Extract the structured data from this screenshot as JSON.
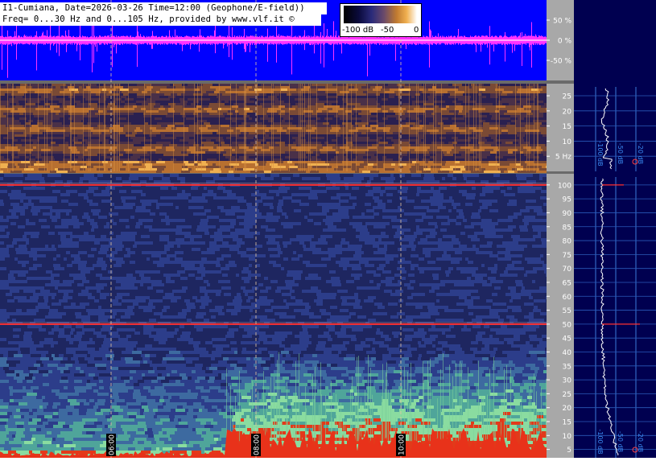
{
  "header": {
    "line1": "I1-Cumiana, Date=2026-03-26 Time=12:00 (Geophone/E-field))",
    "line2": "Freq= 0...30 Hz and 0...105 Hz, provided by www.vlf.it ©"
  },
  "colorbar": {
    "labels": [
      "-100 dB",
      "-50",
      "0"
    ]
  },
  "colors": {
    "waveform_bg": "#0000ff",
    "waveform": "#ff33ff",
    "axis_panel": "#a8a8a8",
    "right_panel": "#000050",
    "reference_line": "#ff3030"
  },
  "chart_data": [
    {
      "type": "line",
      "title": "waveform",
      "ylabel": "",
      "y_ticks": [
        "50 %",
        "0 %",
        "-50 %"
      ],
      "ylim": [
        -100,
        100
      ]
    },
    {
      "type": "heatmap",
      "title": "spectrogram 0...30 Hz",
      "unit_label": "Hz",
      "y_ticks": [
        {
          "label": "25",
          "v": 25
        },
        {
          "label": "20",
          "v": 20
        },
        {
          "label": "15",
          "v": 15
        },
        {
          "label": "10",
          "v": 10
        },
        {
          "label": "5 Hz",
          "v": 5
        }
      ],
      "ylim": [
        0,
        29
      ],
      "bands_hz": [
        7.8,
        14.3,
        20.8,
        27.3
      ],
      "time_markers": [
        "06:00",
        "08:00",
        "10:00"
      ],
      "spectrum_axis_labels": [
        "-100 dB",
        "-50 dB",
        "-20 dB"
      ]
    },
    {
      "type": "heatmap",
      "title": "spectrogram 0...105 Hz",
      "y_ticks": [
        {
          "label": "100",
          "v": 100
        },
        {
          "label": "95",
          "v": 95
        },
        {
          "label": "90",
          "v": 90
        },
        {
          "label": "85",
          "v": 85
        },
        {
          "label": "80",
          "v": 80
        },
        {
          "label": "75",
          "v": 75
        },
        {
          "label": "70",
          "v": 70
        },
        {
          "label": "65",
          "v": 65
        },
        {
          "label": "60",
          "v": 60
        },
        {
          "label": "55",
          "v": 55
        },
        {
          "label": "50",
          "v": 50
        },
        {
          "label": "45",
          "v": 45
        },
        {
          "label": "40",
          "v": 40
        },
        {
          "label": "35",
          "v": 35
        },
        {
          "label": "30",
          "v": 30
        },
        {
          "label": "25",
          "v": 25
        },
        {
          "label": "20",
          "v": 20
        },
        {
          "label": "15",
          "v": 15
        },
        {
          "label": "10",
          "v": 10
        },
        {
          "label": "5",
          "v": 5
        }
      ],
      "ylim": [
        2,
        104
      ],
      "line_frequencies_hz": [
        100,
        50
      ],
      "time_markers": [
        "06:00",
        "08:00",
        "10:00"
      ],
      "spectrum_axis_labels": [
        "-100 dB",
        "-50 dB",
        "-20 dB"
      ]
    }
  ]
}
